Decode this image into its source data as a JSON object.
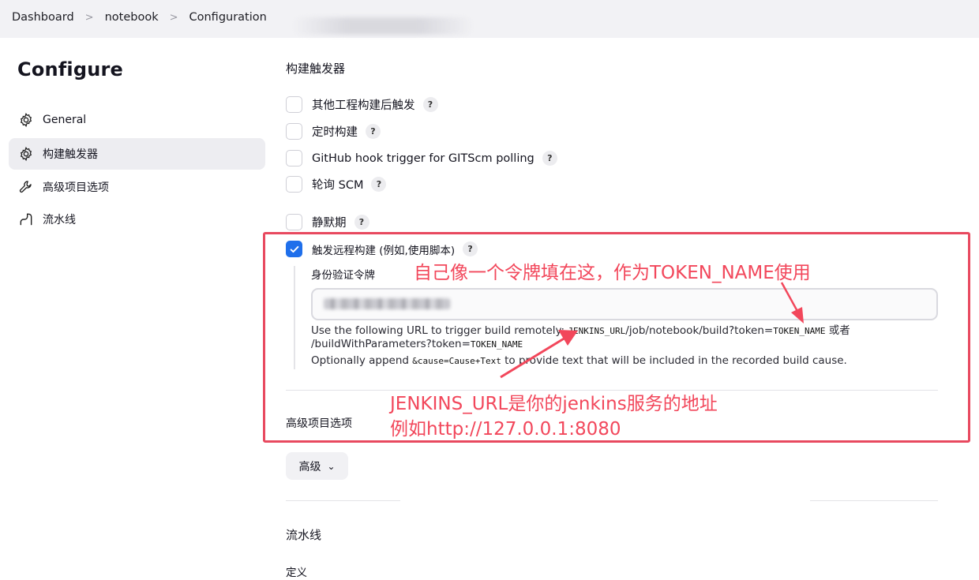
{
  "breadcrumb": {
    "items": [
      "Dashboard",
      "notebook",
      "Configuration"
    ],
    "separator": ">"
  },
  "page_title": "Configure",
  "sidebar": {
    "items": [
      {
        "label": "General",
        "icon": "gear-icon",
        "active": false
      },
      {
        "label": "构建触发器",
        "icon": "gear-icon",
        "active": true
      },
      {
        "label": "高级项目选项",
        "icon": "wrench-icon",
        "active": false
      },
      {
        "label": "流水线",
        "icon": "pipeline-icon",
        "active": false
      }
    ]
  },
  "triggers": {
    "title": "构建触发器",
    "options": [
      {
        "label": "其他工程构建后触发",
        "checked": false,
        "help": "?"
      },
      {
        "label": "定时构建",
        "checked": false,
        "help": "?"
      },
      {
        "label": "GitHub hook trigger for GITScm polling",
        "checked": false,
        "help": "?"
      },
      {
        "label": "轮询 SCM",
        "checked": false,
        "help": "?"
      },
      {
        "label": "静默期",
        "checked": false,
        "help": "?"
      },
      {
        "label": "触发远程构建 (例如,使用脚本)",
        "checked": true,
        "help": "?"
      }
    ],
    "remote": {
      "token_label": "身份验证令牌",
      "url_intro": "Use the following URL to trigger build remotely:",
      "url_code1": "JENKINS_URL",
      "url_path": "/job/notebook/build?token=",
      "url_code2": "TOKEN_NAME",
      "url_or": "或者",
      "line2_path": "/buildWithParameters?token=",
      "line2_code": "TOKEN_NAME",
      "line3_pre": "Optionally append",
      "line3_code": "&cause=Cause+Text",
      "line3_post": "to provide text that will be included in the recorded build cause."
    }
  },
  "advanced": {
    "title": "高级项目选项",
    "button_label": "高级"
  },
  "pipeline": {
    "title": "流水线",
    "definition_label": "定义"
  },
  "annotations": {
    "token_note": "自己像一个令牌填在这，作为TOKEN_NAME使用",
    "url_note_line1": "JENKINS_URL是你的jenkins服务的地址",
    "url_note_line2": "例如http://127.0.0.1:8080"
  },
  "colors": {
    "annotation": "#e8495f",
    "checkbox_checked": "#1f6feb",
    "sidebar_active": "#ededf1"
  }
}
